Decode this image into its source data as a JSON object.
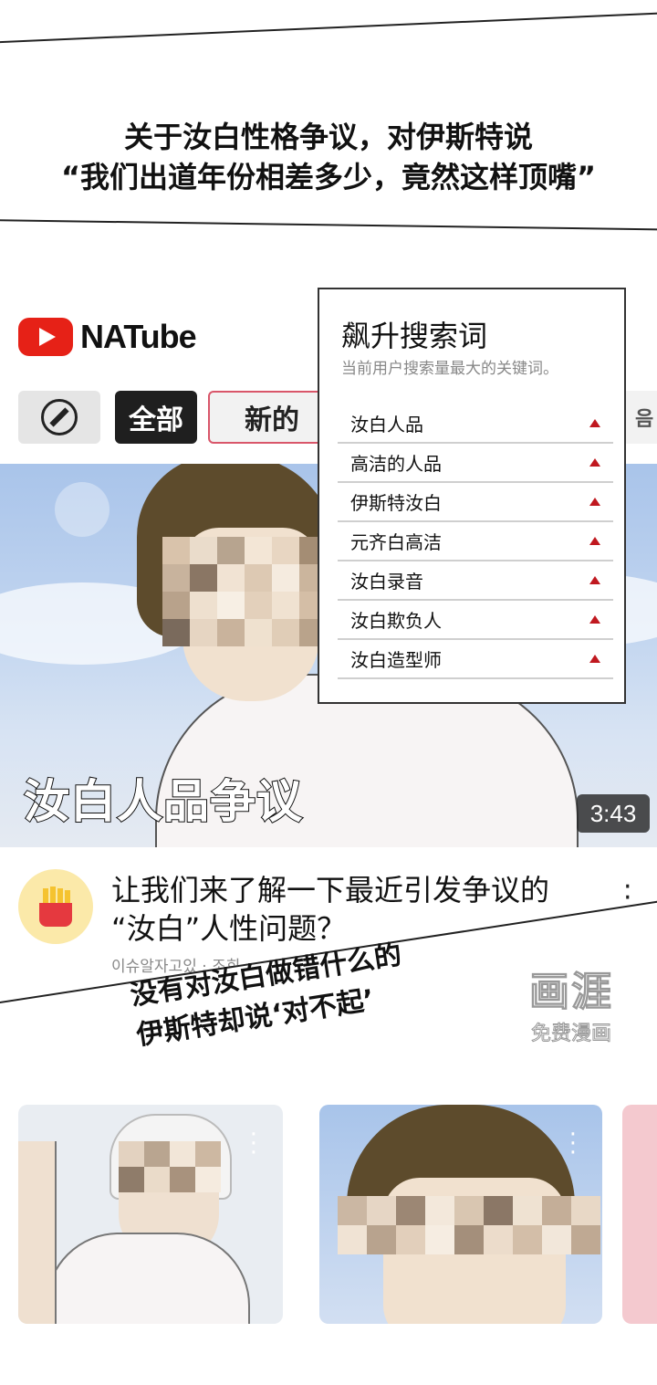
{
  "top_panel": {
    "caption_line1": "关于汝白性格争议，对伊斯特说",
    "caption_line2": "“我们出道年份相差多少，竟然这样顶嘴”"
  },
  "app": {
    "name": "NATube",
    "logo_icon": "youtube-play-icon",
    "brand_color": "#e62117"
  },
  "chips": {
    "all": "全部",
    "new": "新的",
    "more": "음"
  },
  "video": {
    "title_overlay": "汝白人品争议",
    "duration": "3:43",
    "description_line1": "让我们来了解一下最近引发争议的",
    "description_line2": "“汝白”人性问题？",
    "channel": "이슈알자고있 · 조회"
  },
  "trending": {
    "title": "飙升搜索词",
    "subtitle": "当前用户搜索量最大的关键词。",
    "items": [
      {
        "label": "汝白人品"
      },
      {
        "label": "高洁的人品"
      },
      {
        "label": "伊斯特汝白"
      },
      {
        "label": "元齐白高洁"
      },
      {
        "label": "汝白录音"
      },
      {
        "label": "汝白欺负人"
      },
      {
        "label": "汝白造型师"
      }
    ],
    "trend_color": "#c0181f"
  },
  "lower_panel": {
    "caption_line1": "没有对汝白做错什么的",
    "caption_line2": "伊斯特却说‘对不起’"
  },
  "watermark": {
    "big": "画涯",
    "small": "免费漫画"
  }
}
